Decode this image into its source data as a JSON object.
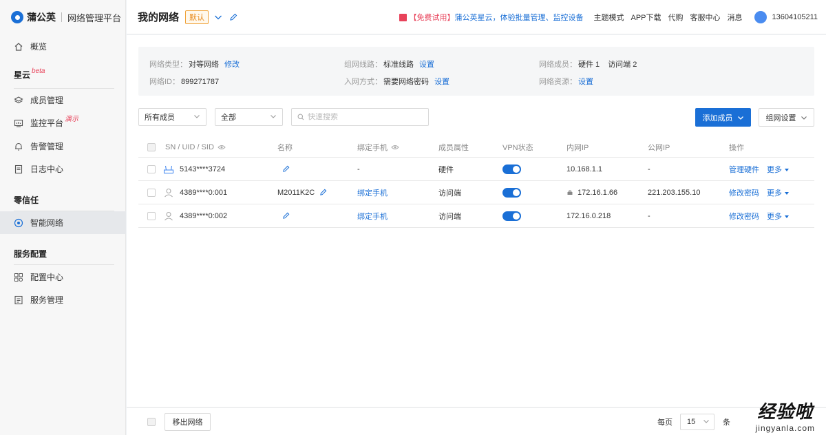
{
  "brand": {
    "name": "蒲公英",
    "platform": "网络管理平台"
  },
  "sidebar": {
    "overview": "概览",
    "groups": [
      {
        "title": "星云",
        "badge": "beta"
      },
      {
        "title": "零信任"
      },
      {
        "title": "服务配置"
      }
    ],
    "items": [
      {
        "label": "成员管理"
      },
      {
        "label": "监控平台",
        "badge": "演示"
      },
      {
        "label": "告警管理"
      },
      {
        "label": "日志中心"
      },
      {
        "label": "智能网络"
      },
      {
        "label": "配置中心"
      },
      {
        "label": "服务管理"
      }
    ]
  },
  "header": {
    "title": "我的网络",
    "tag": "默认",
    "promo_free": "【免费试用】",
    "promo_text": "蒲公英星云，体验批量管理、监控设备",
    "links": [
      "主题模式",
      "APP下载",
      "代购",
      "客服中心",
      "消息"
    ],
    "user": "13604105211"
  },
  "info": {
    "network_type_label": "网络类型：",
    "network_type_value": "对等网络",
    "network_type_action": "修改",
    "network_id_label": "网络ID：",
    "network_id_value": "899271787",
    "line_label": "组网线路：",
    "line_value": "标准线路",
    "line_action": "设置",
    "join_label": "入网方式：",
    "join_value": "需要网络密码",
    "join_action": "设置",
    "members_label": "网络成员：",
    "members_hw": "硬件 1",
    "members_access": "访问端 2",
    "resources_label": "网络资源：",
    "resources_action": "设置"
  },
  "filters": {
    "member_filter": "所有成员",
    "status_filter": "全部",
    "search_placeholder": "快速搜索",
    "add_member": "添加成员",
    "network_settings": "组网设置"
  },
  "table": {
    "headers": {
      "sn": "SN / UID / SID",
      "name": "名称",
      "bind_phone": "绑定手机",
      "attr": "成员属性",
      "vpn": "VPN状态",
      "lan_ip": "内网IP",
      "wan_ip": "公网IP",
      "ops": "操作"
    },
    "rows": [
      {
        "sn": "5143****3724",
        "name": "",
        "bind": "-",
        "attr": "硬件",
        "lan_ip": "10.168.1.1",
        "wan_ip": "-",
        "op": "管理硬件",
        "more": "更多"
      },
      {
        "sn": "4389****0:001",
        "name": "M2011K2C",
        "bind": "绑定手机",
        "attr": "访问端",
        "lan_ip": "172.16.1.66",
        "wan_ip": "221.203.155.10",
        "op": "修改密码",
        "more": "更多"
      },
      {
        "sn": "4389****0:002",
        "name": "",
        "bind": "绑定手机",
        "attr": "访问端",
        "lan_ip": "172.16.0.218",
        "wan_ip": "-",
        "op": "修改密码",
        "more": "更多"
      }
    ]
  },
  "footer": {
    "move_out": "移出网络",
    "per_page_label": "每页",
    "page_size": "15",
    "unit": "条"
  },
  "watermark": {
    "cn": "经验啦",
    "en": "jingyanla.com"
  },
  "colors": {
    "accent": "#1a6fd6",
    "tag": "#e8891a",
    "badge": "#e8425a"
  }
}
